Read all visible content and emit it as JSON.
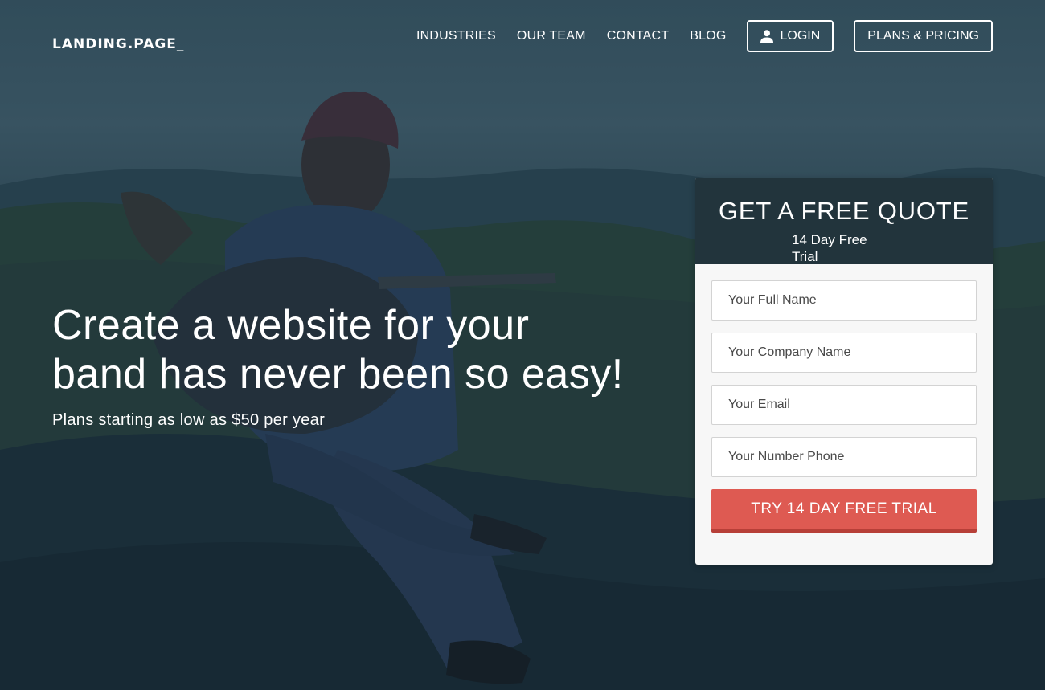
{
  "header": {
    "logo": "LANDING.PAGE_",
    "nav_links": [
      "INDUSTRIES",
      "OUR TEAM",
      "CONTACT",
      "BLOG"
    ],
    "login_label": "LOGIN",
    "login_icon": "user-icon",
    "pricing_label": "PLANS & PRICING"
  },
  "hero": {
    "title_line1": "Create a website for your",
    "title_line2": "band has never been so easy!",
    "subtitle": "Plans starting as low as $50 per year"
  },
  "quote_form": {
    "title": "GET A FREE QUOTE",
    "subtitle": "14 Day Free Trial",
    "fields": {
      "full_name_placeholder": "Your Full Name",
      "company_placeholder": "Your Company Name",
      "email_placeholder": "Your Email",
      "phone_placeholder": "Your Number Phone"
    },
    "submit_label": "TRY 14 DAY FREE TRIAL"
  },
  "colors": {
    "accent": "#de5a52",
    "card_header": "#22343c",
    "overlay": "#163446"
  }
}
